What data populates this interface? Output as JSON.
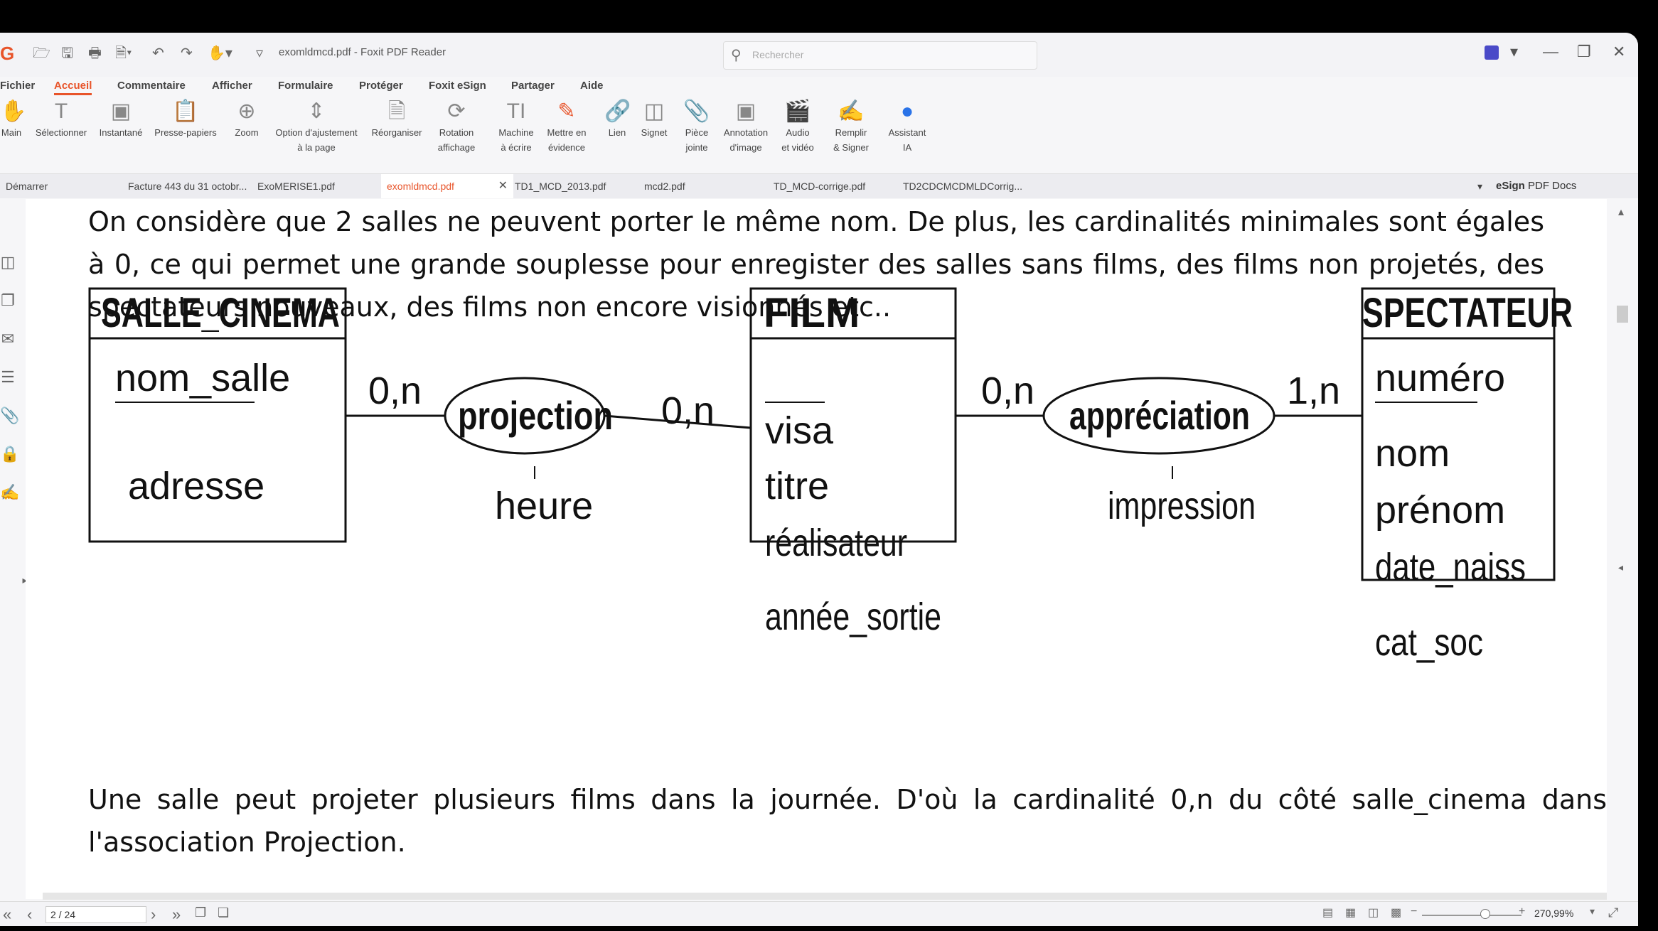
{
  "window": {
    "title": "exomldmcd.pdf - Foxit PDF Reader",
    "search_placeholder": "Rechercher"
  },
  "menu": [
    "Fichier",
    "Accueil",
    "Commentaire",
    "Afficher",
    "Formulaire",
    "Protéger",
    "Foxit eSign",
    "Partager",
    "Aide"
  ],
  "toolbar": {
    "main": "Main",
    "select": "Sélectionner",
    "snapshot": "Instantané",
    "clipboard": "Presse-papiers",
    "zoom": "Zoom",
    "fit_1": "Option d'ajustement",
    "fit_2": "à la page",
    "reorganize": "Réorganiser",
    "rotate_1": "Rotation",
    "rotate_2": "affichage",
    "typewriter_1": "Machine",
    "typewriter_2": "à écrire",
    "highlight_1": "Mettre en",
    "highlight_2": "évidence",
    "link": "Lien",
    "bookmark": "Signet",
    "attach_1": "Pièce",
    "attach_2": "jointe",
    "imgannot_1": "Annotation",
    "imgannot_2": "d'image",
    "av_1": "Audio",
    "av_2": "et vidéo",
    "fillsign_1": "Remplir",
    "fillsign_2": "& Signer",
    "ai_1": "Assistant",
    "ai_2": "IA"
  },
  "tabs": [
    "Démarrer",
    "Facture 443 du 31 octobr...",
    "ExoMERISE1.pdf",
    "exomldmcd.pdf",
    "TD1_MCD_2013.pdf",
    "mcd2.pdf",
    "TD_MCD-corrige.pdf",
    "TD2CDCMCDMLDCorrig..."
  ],
  "esign": {
    "brand": "eSign",
    "label": "PDF Docs"
  },
  "document": {
    "para1_line1": "On considère que 2 salles ne peuvent porter le même nom. De plus, les cardinalités minimales sont égales",
    "para1_line2": "à 0, ce qui permet une grande souplesse pour enregister des salles sans films, des films non projetés, des",
    "para1_line3": "spectateurs nouveaux, des films non encore visionnés etc..",
    "para2_line1": "Une salle peut projeter plusieurs films dans la journée. D'où la cardinalité 0,n du côté salle_cinema dans",
    "para2_line2": "l'association Projection."
  },
  "diagram": {
    "entity1": {
      "name": "SALLE_CINEMA",
      "key": "nom_salle",
      "attrs": [
        "adresse"
      ]
    },
    "entity2": {
      "name": "FILM",
      "key": "visa",
      "attrs": [
        "titre",
        "réalisateur",
        "année_sortie"
      ]
    },
    "entity3": {
      "name": "SPECTATEUR",
      "key": "numéro",
      "attrs": [
        "nom",
        "prénom",
        "date_naiss",
        "cat_soc"
      ]
    },
    "assoc1": {
      "name": "projection",
      "attr": "heure",
      "card_left": "0,n",
      "card_right": "0,n"
    },
    "assoc2": {
      "name": "appréciation",
      "attr": "impression",
      "card_left": "0,n",
      "card_right": "1,n"
    }
  },
  "status": {
    "page": "2 / 24",
    "zoom": "270,99%"
  }
}
